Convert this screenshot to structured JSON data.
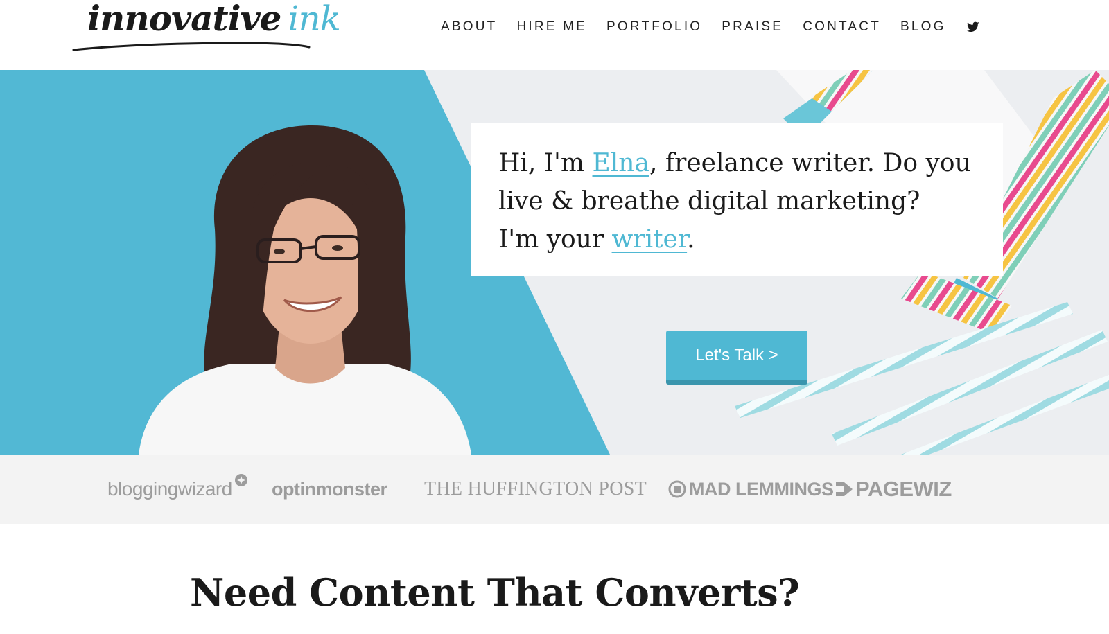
{
  "header": {
    "logo": {
      "word1": "innovative",
      "word2": "ink"
    },
    "nav": [
      {
        "label": "ABOUT"
      },
      {
        "label": "HIRE ME"
      },
      {
        "label": "PORTFOLIO"
      },
      {
        "label": "PRAISE"
      },
      {
        "label": "CONTACT"
      },
      {
        "label": "BLOG"
      }
    ],
    "social_icon": "twitter-icon"
  },
  "hero": {
    "intro": {
      "part1": "Hi, I'm ",
      "name_link": "Elna",
      "part2": ", freelance writer. Do you live & breathe digital marketing?",
      "part3": "I'm your ",
      "writer_link": "writer",
      "part4": "."
    },
    "cta_label": "Let's Talk >"
  },
  "clients": [
    {
      "name": "bloggingwizard"
    },
    {
      "name": "optinmonster"
    },
    {
      "name": "THE HUFFINGTON POST"
    },
    {
      "name": "MAD LEMMINGS"
    },
    {
      "name": "PAGEWIZ"
    }
  ],
  "section": {
    "title": "Need Content That Converts?"
  },
  "colors": {
    "accent": "#4fb8d3",
    "text": "#1a1a1a",
    "strip": "#f3f3f3"
  }
}
